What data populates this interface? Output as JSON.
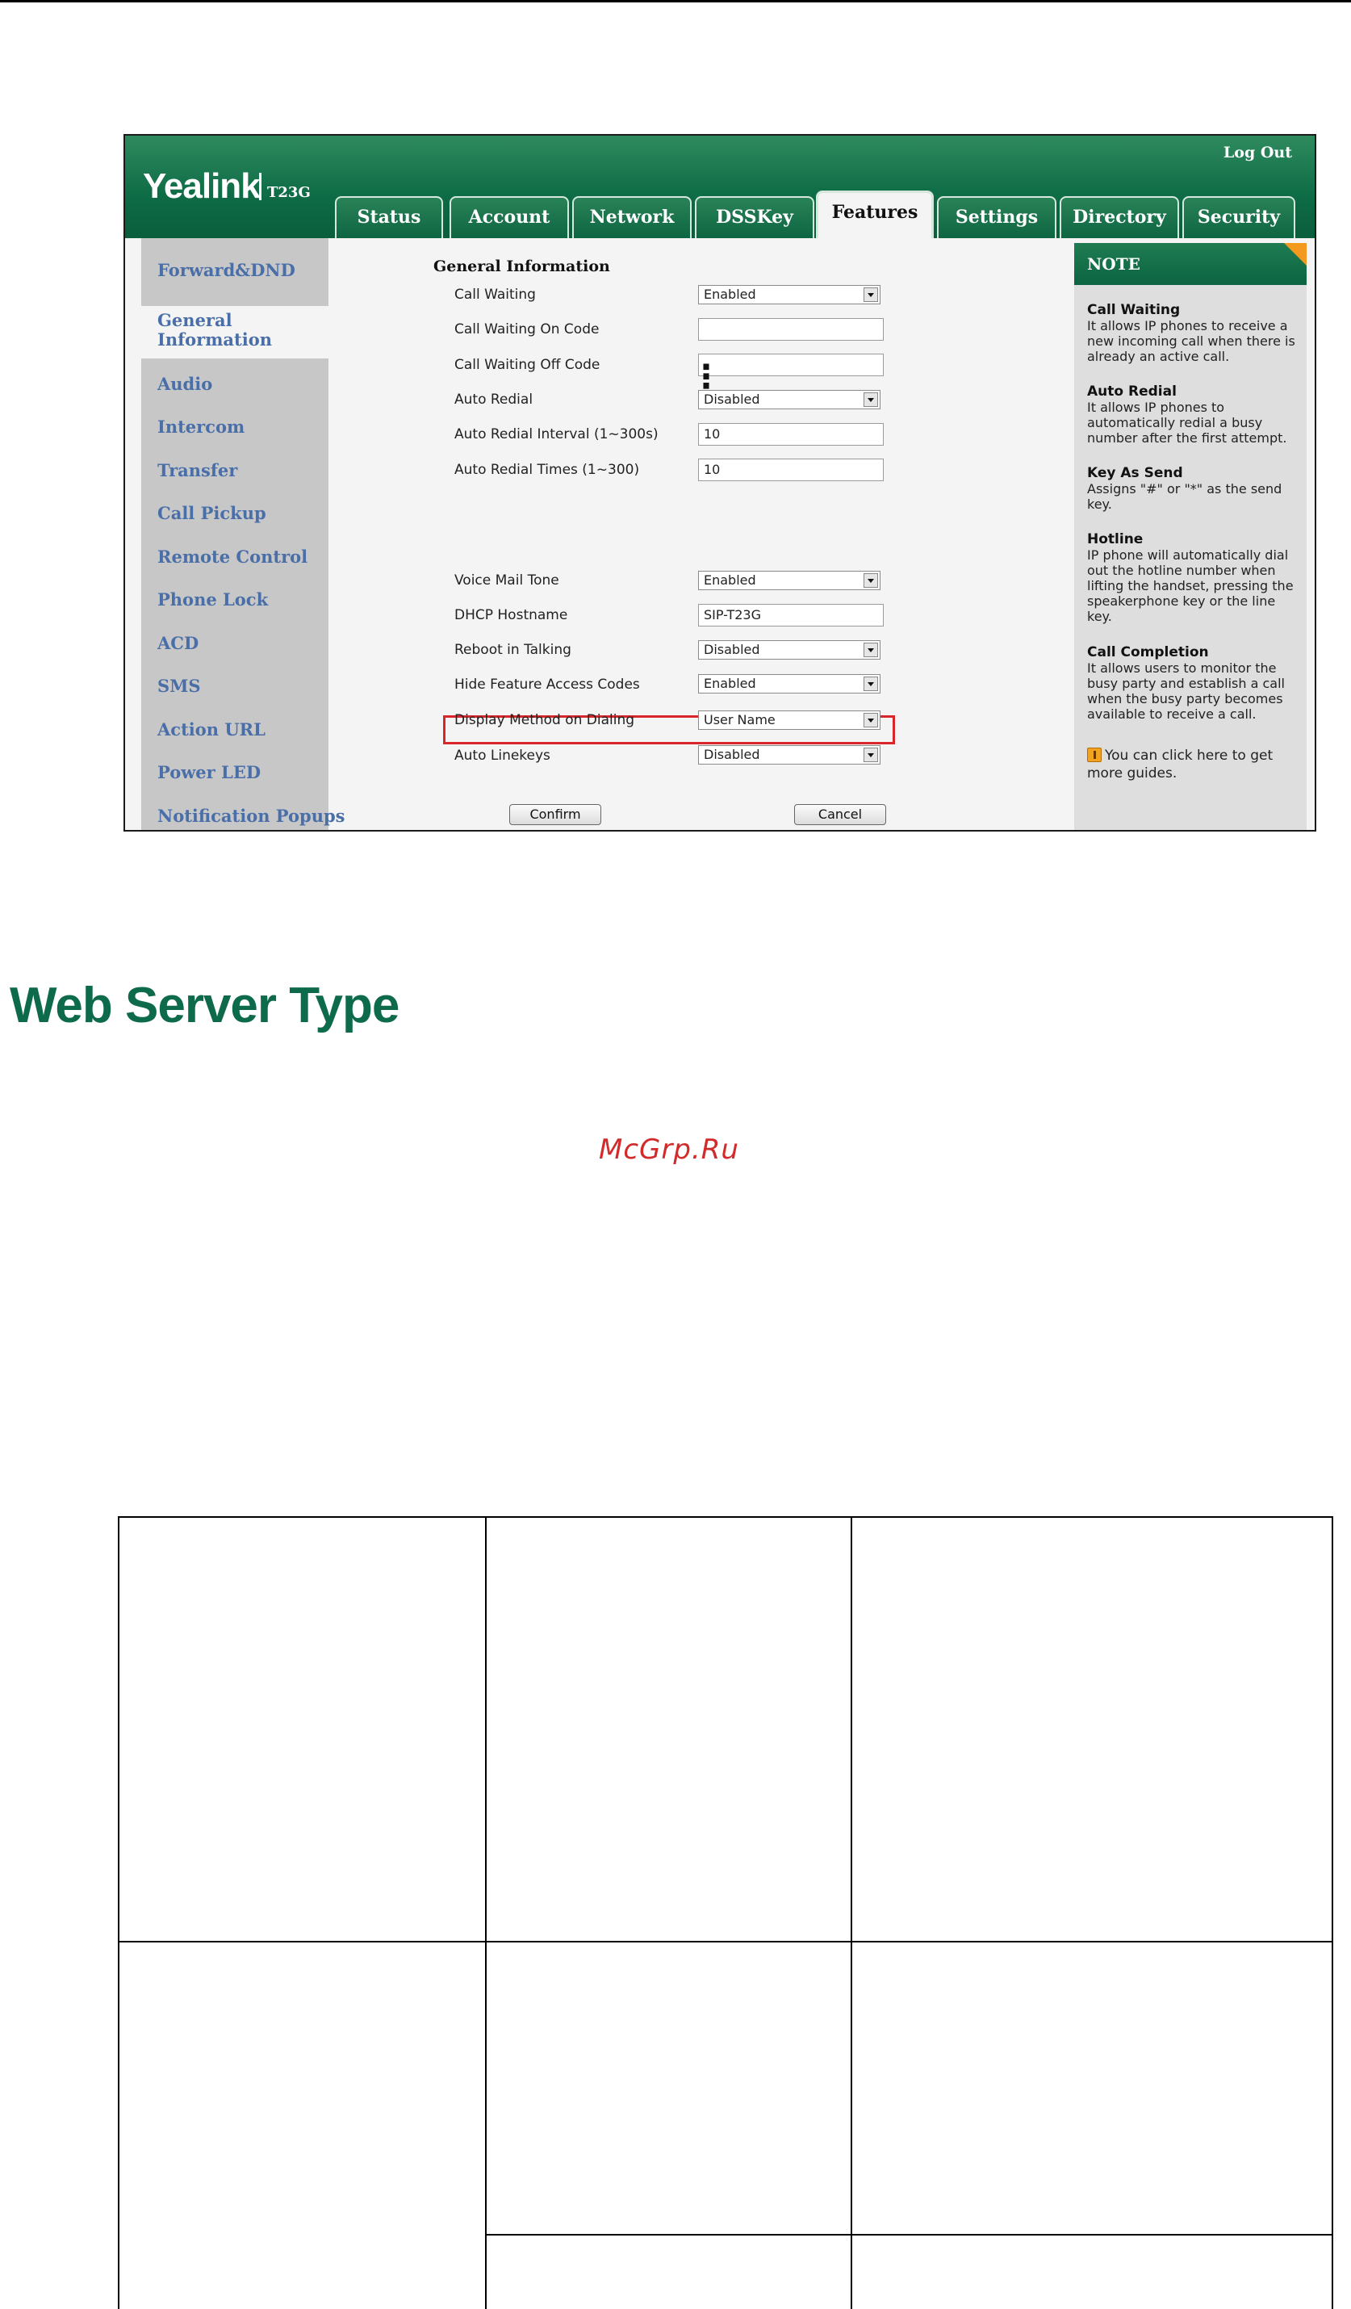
{
  "app": {
    "brand": "Yealink",
    "model": "T23G",
    "logout_label": "Log Out"
  },
  "tabs": [
    {
      "label": "Status"
    },
    {
      "label": "Account"
    },
    {
      "label": "Network"
    },
    {
      "label": "DSSKey"
    },
    {
      "label": "Features",
      "active": true
    },
    {
      "label": "Settings"
    },
    {
      "label": "Directory"
    },
    {
      "label": "Security"
    }
  ],
  "sidebar": {
    "items": [
      {
        "label": "Forward&DND"
      },
      {
        "label": "General Information",
        "active": true
      },
      {
        "label": "Audio"
      },
      {
        "label": "Intercom"
      },
      {
        "label": "Transfer"
      },
      {
        "label": "Call Pickup"
      },
      {
        "label": "Remote Control"
      },
      {
        "label": "Phone Lock"
      },
      {
        "label": "ACD"
      },
      {
        "label": "SMS"
      },
      {
        "label": "Action URL"
      },
      {
        "label": "Power LED"
      },
      {
        "label": "Notification Popups"
      }
    ]
  },
  "form": {
    "section_title": "General Information",
    "fields": [
      {
        "label": "Call Waiting",
        "type": "select",
        "value": "Enabled"
      },
      {
        "label": "Call Waiting On Code",
        "type": "text",
        "value": ""
      },
      {
        "label": "Call Waiting Off Code",
        "type": "text",
        "value": ""
      },
      {
        "label": "Auto Redial",
        "type": "select",
        "value": "Disabled"
      },
      {
        "label": "Auto Redial Interval (1~300s)",
        "type": "text",
        "value": "10"
      },
      {
        "label": "Auto Redial Times (1~300)",
        "type": "text",
        "value": "10"
      },
      {
        "label": "Voice Mail Tone",
        "type": "select",
        "value": "Enabled"
      },
      {
        "label": "DHCP Hostname",
        "type": "text",
        "value": "SIP-T23G"
      },
      {
        "label": "Reboot in Talking",
        "type": "select",
        "value": "Disabled"
      },
      {
        "label": "Hide Feature Access Codes",
        "type": "select",
        "value": "Enabled"
      },
      {
        "label": "Display Method on Dialing",
        "type": "select",
        "value": "User Name",
        "highlighted": true
      },
      {
        "label": "Auto Linekeys",
        "type": "select",
        "value": "Disabled"
      }
    ],
    "ellipsis": "⋮",
    "confirm_label": "Confirm",
    "cancel_label": "Cancel"
  },
  "note": {
    "title": "NOTE",
    "entries": [
      {
        "heading": "Call Waiting",
        "text": "It allows IP phones to receive a new incoming call when there is already an active call."
      },
      {
        "heading": "Auto Redial",
        "text": "It allows IP phones to automatically redial a busy number after the first attempt."
      },
      {
        "heading": "Key As Send",
        "text": "Assigns \"#\" or \"*\" as the send key."
      },
      {
        "heading": "Hotline",
        "text": "IP phone will automatically dial out the hotline number when lifting the handset, pressing the speakerphone key or the line key."
      },
      {
        "heading": "Call Completion",
        "text": "It allows users to monitor the busy party and establish a call when the busy party becomes available to receive a call."
      }
    ],
    "guide_text": "You can click here to get more guides."
  },
  "document": {
    "heading": "Web Server Type",
    "watermark": "McGrp.Ru"
  },
  "colors": {
    "brand_green": "#0d6b45",
    "heading_green": "#0d6a4a",
    "highlight_red": "#d8262a",
    "watermark_red": "#d32a2a",
    "sidebar_link": "#4a6fa8"
  }
}
